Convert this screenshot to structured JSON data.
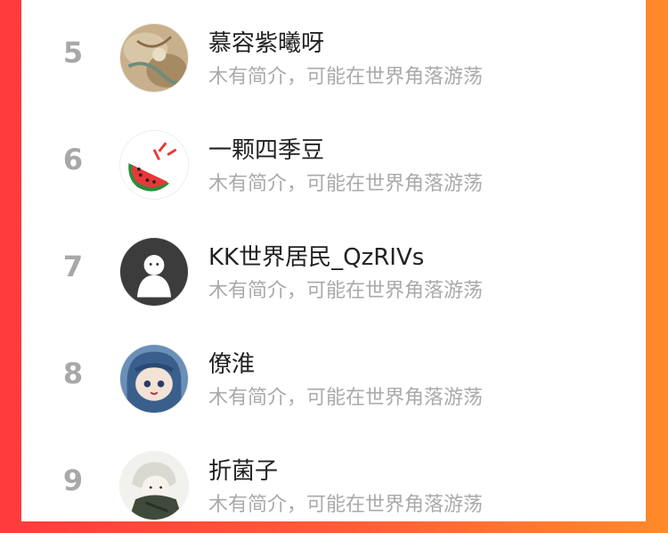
{
  "colors": {
    "background_left": "#ff3b3b",
    "background_right": "#ff8a2a",
    "rank_color": "#a8a8a8",
    "name_color": "#222222",
    "bio_color": "#aaaaaa"
  },
  "ranking_list": [
    {
      "rank": "5",
      "name": "慕容紫曦呀",
      "bio": "木有简介，可能在世界角落游荡",
      "avatar": "illustrated-avatar"
    },
    {
      "rank": "6",
      "name": "一颗四季豆",
      "bio": "木有简介，可能在世界角落游荡",
      "avatar": "watermelon-avatar"
    },
    {
      "rank": "7",
      "name": "KK世界居民_QzRIVs",
      "bio": "木有简介，可能在世界角落游荡",
      "avatar": "default-user-avatar"
    },
    {
      "rank": "8",
      "name": "僚淮",
      "bio": "木有简介，可能在世界角落游荡",
      "avatar": "anime-avatar"
    },
    {
      "rank": "9",
      "name": "折菌子",
      "bio": "木有简介，可能在世界角落游荡",
      "avatar": "sketch-avatar"
    }
  ]
}
